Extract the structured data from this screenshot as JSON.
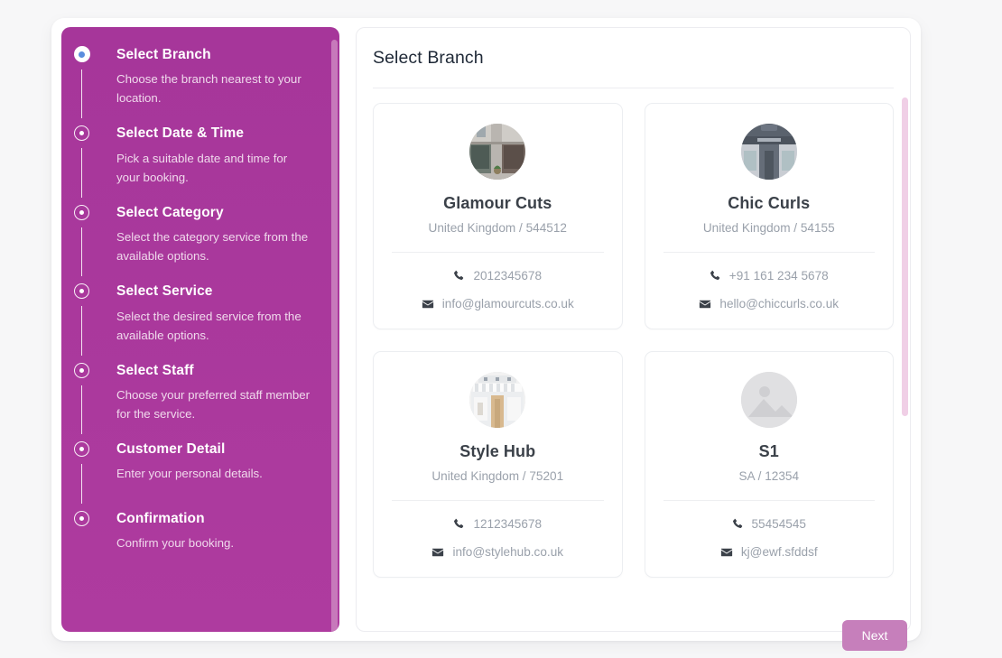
{
  "theme": {
    "sidebar_color": "#a6369a",
    "sidebar_color_end": "#ae3b9f",
    "active_dot_color": "#5b8dde",
    "next_button_color": "#c67fbb",
    "muted_text_color": "#9aa1ab",
    "title_color": "#3b4149",
    "page_background": "#f7f7f8",
    "content_scrollbar_color": "#f0cfe6",
    "sidebar_scrollbar_color": "#c779bb"
  },
  "stepper": {
    "steps": [
      {
        "title": "Select Branch",
        "description": "Choose the branch nearest to your location.",
        "state": "active"
      },
      {
        "title": "Select Date & Time",
        "description": "Pick a suitable date and time for your booking.",
        "state": "inactive"
      },
      {
        "title": "Select Category",
        "description": "Select the category service from the available options.",
        "state": "inactive"
      },
      {
        "title": "Select Service",
        "description": "Select the desired service from the available options.",
        "state": "inactive"
      },
      {
        "title": "Select Staff",
        "description": "Choose your preferred staff member for the service.",
        "state": "inactive"
      },
      {
        "title": "Customer Detail",
        "description": "Enter your personal details.",
        "state": "inactive"
      },
      {
        "title": "Confirmation",
        "description": "Confirm your booking.",
        "state": "inactive"
      }
    ]
  },
  "main": {
    "title": "Select Branch",
    "branches": [
      {
        "name": "Glamour Cuts",
        "location": "United Kingdom / 544512",
        "phone": "2012345678",
        "email": "info@glamourcuts.co.uk",
        "avatar_type": "storefront-photo"
      },
      {
        "name": "Chic Curls",
        "location": "United Kingdom / 54155",
        "phone": "+91 161 234 5678",
        "email": "hello@chiccurls.co.uk",
        "avatar_type": "storefront-photo-dark"
      },
      {
        "name": "Style Hub",
        "location": "United Kingdom / 75201",
        "phone": "1212345678",
        "email": "info@stylehub.co.uk",
        "avatar_type": "storefront-photo-light"
      },
      {
        "name": "S1",
        "location": "SA / 12354",
        "phone": "55454545",
        "email": "kj@ewf.sfddsf",
        "avatar_type": "placeholder-image-icon"
      }
    ]
  },
  "footer": {
    "next_label": "Next"
  }
}
